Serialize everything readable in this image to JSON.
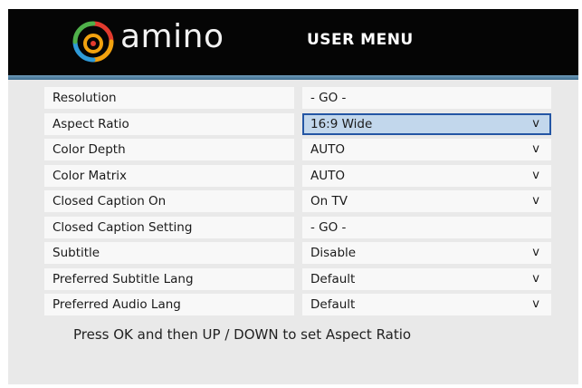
{
  "header": {
    "brand": "amino",
    "title": "USER MENU"
  },
  "menu": {
    "items": [
      {
        "label": "Resolution",
        "value": "- GO -",
        "dropdown": false
      },
      {
        "label": "Aspect Ratio",
        "value": "16:9 Wide",
        "dropdown": true,
        "selected": true
      },
      {
        "label": "Color Depth",
        "value": "AUTO",
        "dropdown": true
      },
      {
        "label": "Color Matrix",
        "value": "AUTO",
        "dropdown": true
      },
      {
        "label": "Closed Caption On",
        "value": "On TV",
        "dropdown": true
      },
      {
        "label": "Closed Caption Setting",
        "value": "- GO -",
        "dropdown": false
      },
      {
        "label": "Subtitle",
        "value": "Disable",
        "dropdown": true
      },
      {
        "label": "Preferred Subtitle Lang",
        "value": "Default",
        "dropdown": true
      },
      {
        "label": "Preferred Audio Lang",
        "value": "Default",
        "dropdown": true
      }
    ],
    "dropdown_glyph": "v"
  },
  "footer": {
    "hint": "Press OK and then UP / DOWN to set Aspect Ratio"
  },
  "colors": {
    "header_bg": "#050505",
    "accent_stripe": "#4f7fa0",
    "selection_bg": "#c2d7ec",
    "selection_border": "#2456a4",
    "cell_bg": "#f8f8f8",
    "panel_bg": "#e9e9e9"
  }
}
